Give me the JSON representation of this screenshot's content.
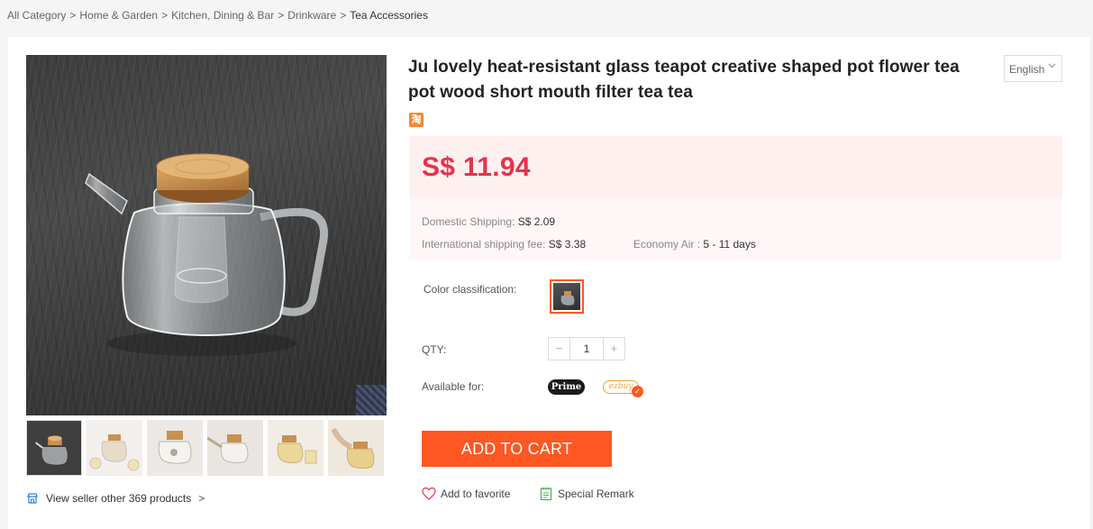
{
  "breadcrumb": [
    {
      "label": "All Category"
    },
    {
      "label": "Home & Garden"
    },
    {
      "label": "Kitchen, Dining & Bar"
    },
    {
      "label": "Drinkware"
    },
    {
      "label": "Tea Accessories"
    }
  ],
  "breadcrumb_separator": ">",
  "product": {
    "title": "Ju lovely heat-resistant glass teapot creative shaped pot flower tea pot wood short mouth filter tea tea",
    "source_badge": "淘",
    "price": "S$ 11.94"
  },
  "language": {
    "selected": "English"
  },
  "shipping": {
    "domestic_label": "Domestic Shipping:",
    "domestic_value": "S$ 2.09",
    "international_label": "International shipping fee:",
    "international_value": "S$ 3.38",
    "economy_label": "Economy Air :",
    "economy_value": "5 - 11 days"
  },
  "options": {
    "color_label": "Color classification:",
    "qty_label": "QTY:",
    "qty_value": "1",
    "qty_minus": "−",
    "qty_plus": "+",
    "available_label": "Available for:",
    "prime_badge": "Prime",
    "ezbuy_badge": "ezbuy",
    "check_glyph": "✓"
  },
  "actions": {
    "add_to_cart": "ADD TO CART",
    "add_to_favorite": "Add to favorite",
    "special_remark": "Special Remark"
  },
  "seller": {
    "link_label": "View seller other 369 products",
    "chevron": ">"
  },
  "icons": {
    "lang_caret": "chevron-down-icon",
    "fav": "heart-icon",
    "remark": "notepad-icon",
    "seller": "store-icon"
  },
  "colors": {
    "accent": "#ff5722",
    "price": "#e8324a",
    "price_bg": "#fff0f0",
    "ship_bg": "#fff7f7",
    "ezbuy": "#f0a030",
    "remark_icon": "#4caf50"
  }
}
